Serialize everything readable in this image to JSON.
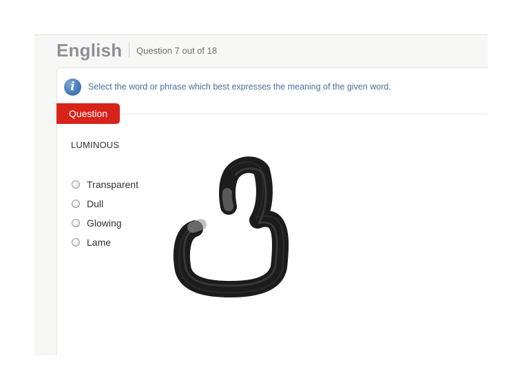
{
  "header": {
    "subject": "English",
    "counter": "Question 7 out of 18"
  },
  "instruction": {
    "icon": "info-icon",
    "text": "Select the word or phrase which best expresses the meaning of the given word."
  },
  "question": {
    "tab_label": "Question",
    "word": "LUMINOUS",
    "options": [
      {
        "label": "Transparent",
        "selected": false
      },
      {
        "label": "Dull",
        "selected": false
      },
      {
        "label": "Glowing",
        "selected": false
      },
      {
        "label": "Lame",
        "selected": false
      }
    ]
  },
  "colors": {
    "accent_red": "#d8231a",
    "info_blue": "#4b7bb8",
    "instruction_text": "#4a6f9c",
    "subject_grey": "#8d9096",
    "scribble": "#1a1a1a"
  }
}
